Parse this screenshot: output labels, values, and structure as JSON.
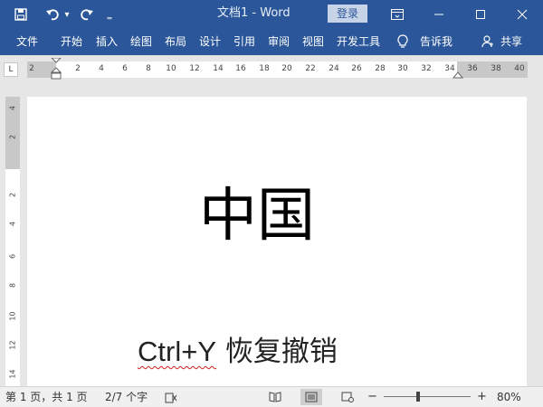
{
  "titlebar": {
    "doc_title": "文档1  -  Word",
    "login_label": "登录",
    "dropdown_glyph": "▾",
    "customize_glyph": "‗"
  },
  "menu": {
    "tabs": [
      "文件",
      "开始",
      "插入",
      "绘图",
      "布局",
      "设计",
      "引用",
      "审阅",
      "视图",
      "开发工具"
    ],
    "tell_me": "告诉我",
    "share": "共享"
  },
  "ruler": {
    "corner_glyph": "L",
    "h_labels": [
      "2",
      "2",
      "4",
      "6",
      "8",
      "10",
      "12",
      "14",
      "16",
      "18",
      "20",
      "22",
      "24",
      "26",
      "28",
      "30",
      "32",
      "34",
      "36",
      "38",
      "40"
    ],
    "v_labels": [
      "4",
      "2",
      "2",
      "4",
      "6",
      "8",
      "10",
      "12",
      "14"
    ]
  },
  "document": {
    "heading": "中国",
    "line_ctrl": "Ctrl+Y",
    "line_rest": " 恢复撤销"
  },
  "statusbar": {
    "page_info": "第 1 页，共 1 页",
    "word_count": "2/7 个字",
    "zoom_minus": "−",
    "zoom_plus": "+",
    "zoom_level": "80%"
  },
  "colors": {
    "brand": "#2b579a",
    "spellcheck": "#d02020"
  }
}
